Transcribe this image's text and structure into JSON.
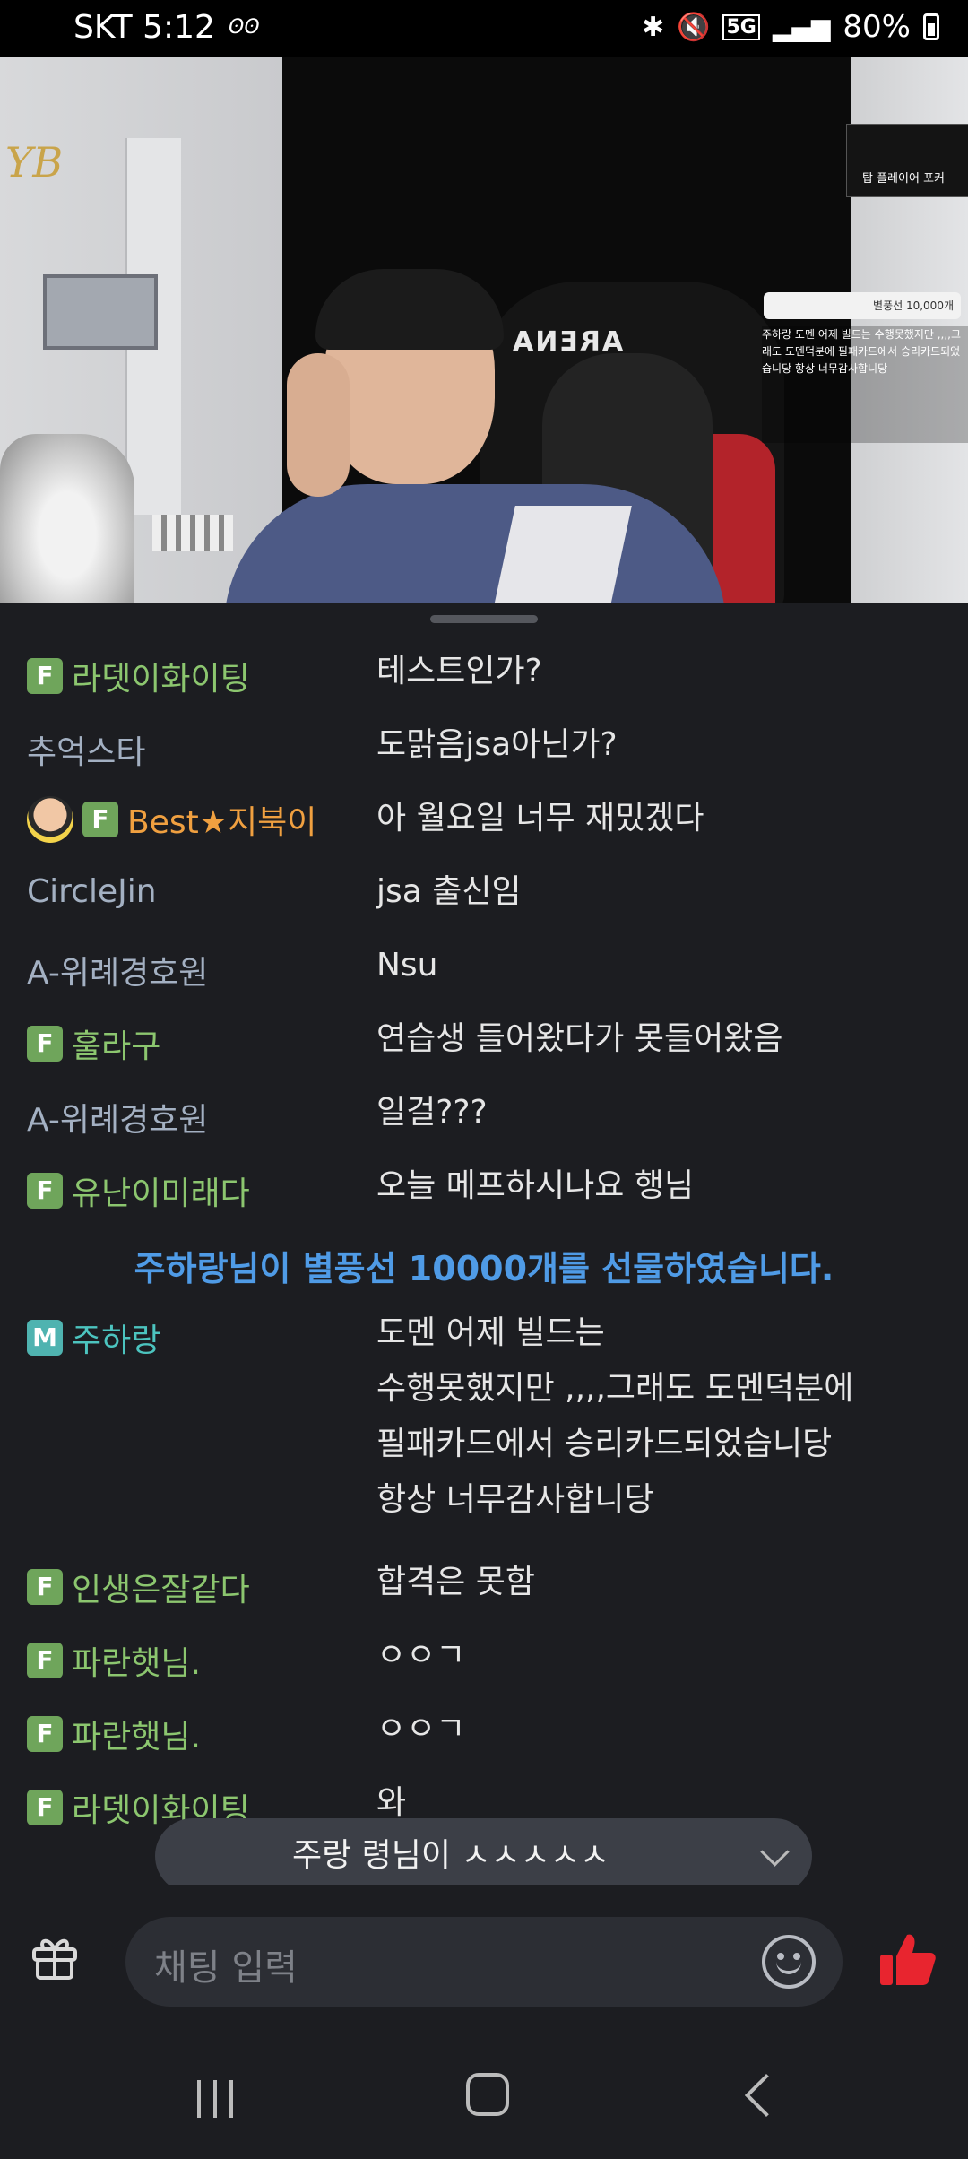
{
  "status_bar": {
    "carrier_time": "SKT 5:12",
    "extra_icon": "ʘʘ",
    "network": "5G",
    "battery": "80%"
  },
  "video": {
    "logo_text": "YB",
    "chair_brand": "ARENA",
    "overlay_title": "탑 플레이어 포커",
    "overlay_balloon": "별풍선 10,000개",
    "overlay_chat": "주하랑 도멘 어제 빌드는 수행못했지만 ,,,,그래도 도멘덕분에 필패카드에서 승리카드되었습니당 항상 너무감사합니당"
  },
  "chat": {
    "messages": [
      {
        "nick": "라뎃이화이팅",
        "badge": "F",
        "text": "테스트인가?"
      },
      {
        "nick": "추억스타",
        "badge": "",
        "text": "도맑음jsa아닌가?"
      },
      {
        "nick": "Best★지북이",
        "badge": "F",
        "text": "아 월요일 너무 재밌겠다"
      },
      {
        "nick": "CircleJin",
        "badge": "",
        "text": "jsa 출신임"
      },
      {
        "nick": "A-위례경호원",
        "badge": "",
        "text": "Nsu"
      },
      {
        "nick": "훌라구",
        "badge": "F",
        "text": "연습생 들어왔다가 못들어왔음"
      },
      {
        "nick": "A-위례경호원",
        "badge": "",
        "text": "일걸???"
      },
      {
        "nick": "유난이미래다",
        "badge": "F",
        "text": "오늘 메프하시나요 행님"
      },
      {
        "nick": "인생은잘같다",
        "badge": "F",
        "text": "합격은 못함"
      },
      {
        "nick": "파란햇님.",
        "badge": "F",
        "text": "ㅇㅇㄱ"
      },
      {
        "nick": "파란햇님.",
        "badge": "F",
        "text": "ㅇㅇㄱ"
      },
      {
        "nick": "라뎃이화이팅",
        "badge": "F",
        "text": "와"
      }
    ],
    "notice": "주하랑님이 별풍선 10000개를 선물하였습니다.",
    "gift_message": {
      "nick": "주하랑",
      "badge": "M",
      "lines": [
        "도멘 어제 빌드는",
        "수행못했지만 ,,,,그래도 도멘덕분에",
        "필패카드에서 승리카드되었습니당",
        "항상 너무감사합니당"
      ]
    }
  },
  "toast": {
    "text": "주랑 령님이 ㅅㅅㅅㅅㅅ"
  },
  "input": {
    "placeholder": "채팅 입력"
  },
  "colors": {
    "accent_blue": "#4f9be6",
    "badge_green": "#6fa55b",
    "badge_teal": "#4fb3b0",
    "like_red": "#e8252f",
    "nick_orange": "#f0a040"
  }
}
